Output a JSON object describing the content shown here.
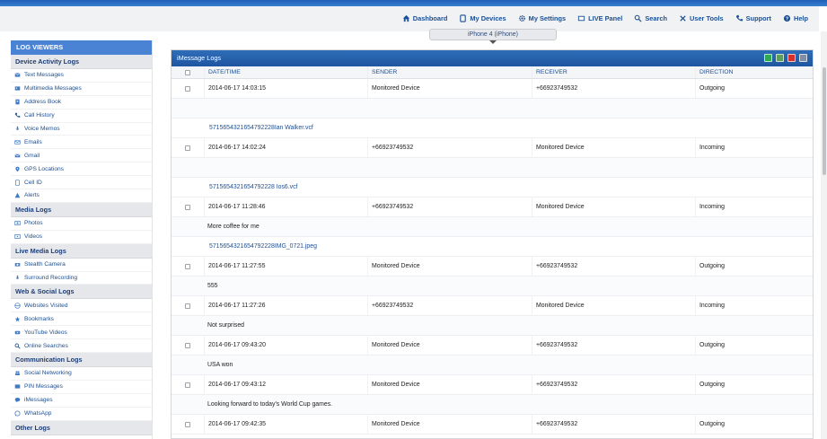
{
  "topnav": {
    "items": [
      {
        "label": "Dashboard",
        "icon": "home-icon"
      },
      {
        "label": "My Devices",
        "icon": "device-icon"
      },
      {
        "label": "My Settings",
        "icon": "gear-icon"
      },
      {
        "label": "LIVE Panel",
        "icon": "live-panel-icon"
      },
      {
        "label": "Search",
        "icon": "search-icon"
      },
      {
        "label": "User Tools",
        "icon": "tools-icon"
      },
      {
        "label": "Support",
        "icon": "phone-icon"
      },
      {
        "label": "Help",
        "icon": "help-icon"
      }
    ]
  },
  "device": {
    "label": "iPhone 4 (iPhone)"
  },
  "sidebar": {
    "header": "LOG VIEWERS",
    "groups": [
      {
        "title": "Device Activity Logs",
        "items": [
          {
            "label": "Text Messages",
            "icon": "sms-icon"
          },
          {
            "label": "Multimedia Messages",
            "icon": "mms-icon"
          },
          {
            "label": "Address Book",
            "icon": "address-book-icon"
          },
          {
            "label": "Call History",
            "icon": "phone-icon"
          },
          {
            "label": "Voice Memos",
            "icon": "microphone-icon"
          },
          {
            "label": "Emails",
            "icon": "email-icon"
          },
          {
            "label": "Gmail",
            "icon": "gmail-icon"
          },
          {
            "label": "GPS Locations",
            "icon": "location-pin-icon"
          },
          {
            "label": "Cell ID",
            "icon": "cell-id-icon"
          },
          {
            "label": "Alerts",
            "icon": "alert-icon"
          }
        ]
      },
      {
        "title": "Media Logs",
        "items": [
          {
            "label": "Photos",
            "icon": "photo-icon"
          },
          {
            "label": "Videos",
            "icon": "video-icon"
          }
        ]
      },
      {
        "title": "Live Media Logs",
        "items": [
          {
            "label": "Stealth Camera",
            "icon": "camera-icon"
          },
          {
            "label": "Surround Recording",
            "icon": "microphone-icon"
          }
        ]
      },
      {
        "title": "Web & Social Logs",
        "items": [
          {
            "label": "Websites Visited",
            "icon": "globe-icon"
          },
          {
            "label": "Bookmarks",
            "icon": "star-icon"
          },
          {
            "label": "YouTube Videos",
            "icon": "youtube-icon"
          },
          {
            "label": "Online Searches",
            "icon": "search-icon"
          }
        ]
      },
      {
        "title": "Communication Logs",
        "items": [
          {
            "label": "Social Networking",
            "icon": "people-icon"
          },
          {
            "label": "PIN Messages",
            "icon": "pin-icon"
          },
          {
            "label": "iMessages",
            "icon": "imessage-icon"
          },
          {
            "label": "WhatsApp",
            "icon": "whatsapp-icon"
          }
        ]
      },
      {
        "title": "Other Logs",
        "items": []
      }
    ]
  },
  "panel": {
    "title": "iMessage Logs",
    "tools": [
      {
        "name": "export-excel-icon",
        "color": "#2fa84f"
      },
      {
        "name": "export-csv-icon",
        "color": "#5aa05a"
      },
      {
        "name": "export-pdf-icon",
        "color": "#d8312a"
      },
      {
        "name": "print-icon",
        "color": "#7d8ea6"
      }
    ],
    "columns": {
      "date": "DATE/TIME",
      "sender": "SENDER",
      "receiver": "RECEIVER",
      "direction": "DIRECTION"
    },
    "rows": [
      {
        "type": "main",
        "date": "2014-06-17 14:03:15",
        "sender": "Monitored Device",
        "receiver": "+66923749532",
        "direction": "Outgoing"
      },
      {
        "type": "text",
        "text": ""
      },
      {
        "type": "attachment",
        "text": "5715654321654792228Ian Walker.vcf"
      },
      {
        "type": "main",
        "date": "2014-06-17 14:02:24",
        "sender": "+66923749532",
        "receiver": "Monitored Device",
        "direction": "Incoming"
      },
      {
        "type": "text",
        "text": ""
      },
      {
        "type": "attachment",
        "text": "5715654321654792228 Ios6.vcf"
      },
      {
        "type": "main",
        "date": "2014-06-17 11:28:46",
        "sender": "+66923749532",
        "receiver": "Monitored Device",
        "direction": "Incoming"
      },
      {
        "type": "text",
        "text": "More coffee for me"
      },
      {
        "type": "attachment",
        "text": "5715654321654792228IMG_0721.jpeg"
      },
      {
        "type": "main",
        "date": "2014-06-17 11:27:55",
        "sender": "Monitored Device",
        "receiver": "+66923749532",
        "direction": "Outgoing"
      },
      {
        "type": "text",
        "text": "555"
      },
      {
        "type": "main",
        "date": "2014-06-17 11:27:26",
        "sender": "+66923749532",
        "receiver": "Monitored Device",
        "direction": "Incoming"
      },
      {
        "type": "text",
        "text": "Not surprised"
      },
      {
        "type": "main",
        "date": "2014-06-17 09:43:20",
        "sender": "Monitored Device",
        "receiver": "+66923749532",
        "direction": "Outgoing"
      },
      {
        "type": "text",
        "text": "USA won"
      },
      {
        "type": "main",
        "date": "2014-06-17 09:43:12",
        "sender": "Monitored Device",
        "receiver": "+66923749532",
        "direction": "Outgoing"
      },
      {
        "type": "text",
        "text": "Looking forward to today's World Cup games."
      },
      {
        "type": "main",
        "date": "2014-06-17 09:42:35",
        "sender": "Monitored Device",
        "receiver": "+66923749532",
        "direction": "Outgoing"
      }
    ]
  }
}
